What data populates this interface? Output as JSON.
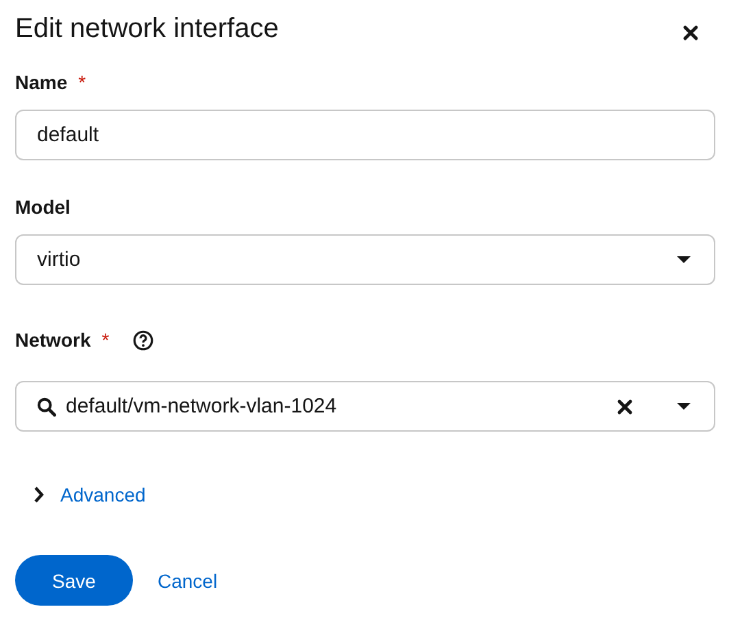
{
  "dialog": {
    "title": "Edit network interface",
    "closable": true
  },
  "fields": [
    {
      "kind": "text",
      "label": "Name",
      "required_mark": "*",
      "value": "default"
    },
    {
      "kind": "select",
      "label": "Model",
      "value": "virtio"
    },
    {
      "kind": "typeahead",
      "label": "Network",
      "required_mark": "*",
      "help": true,
      "value": "default/vm-network-vlan-1024",
      "clearable": true
    }
  ],
  "advanced": {
    "label": "Advanced",
    "expanded": false
  },
  "buttons": [
    {
      "kind": "primary",
      "label": "Save"
    },
    {
      "kind": "link",
      "label": "Cancel"
    }
  ]
}
